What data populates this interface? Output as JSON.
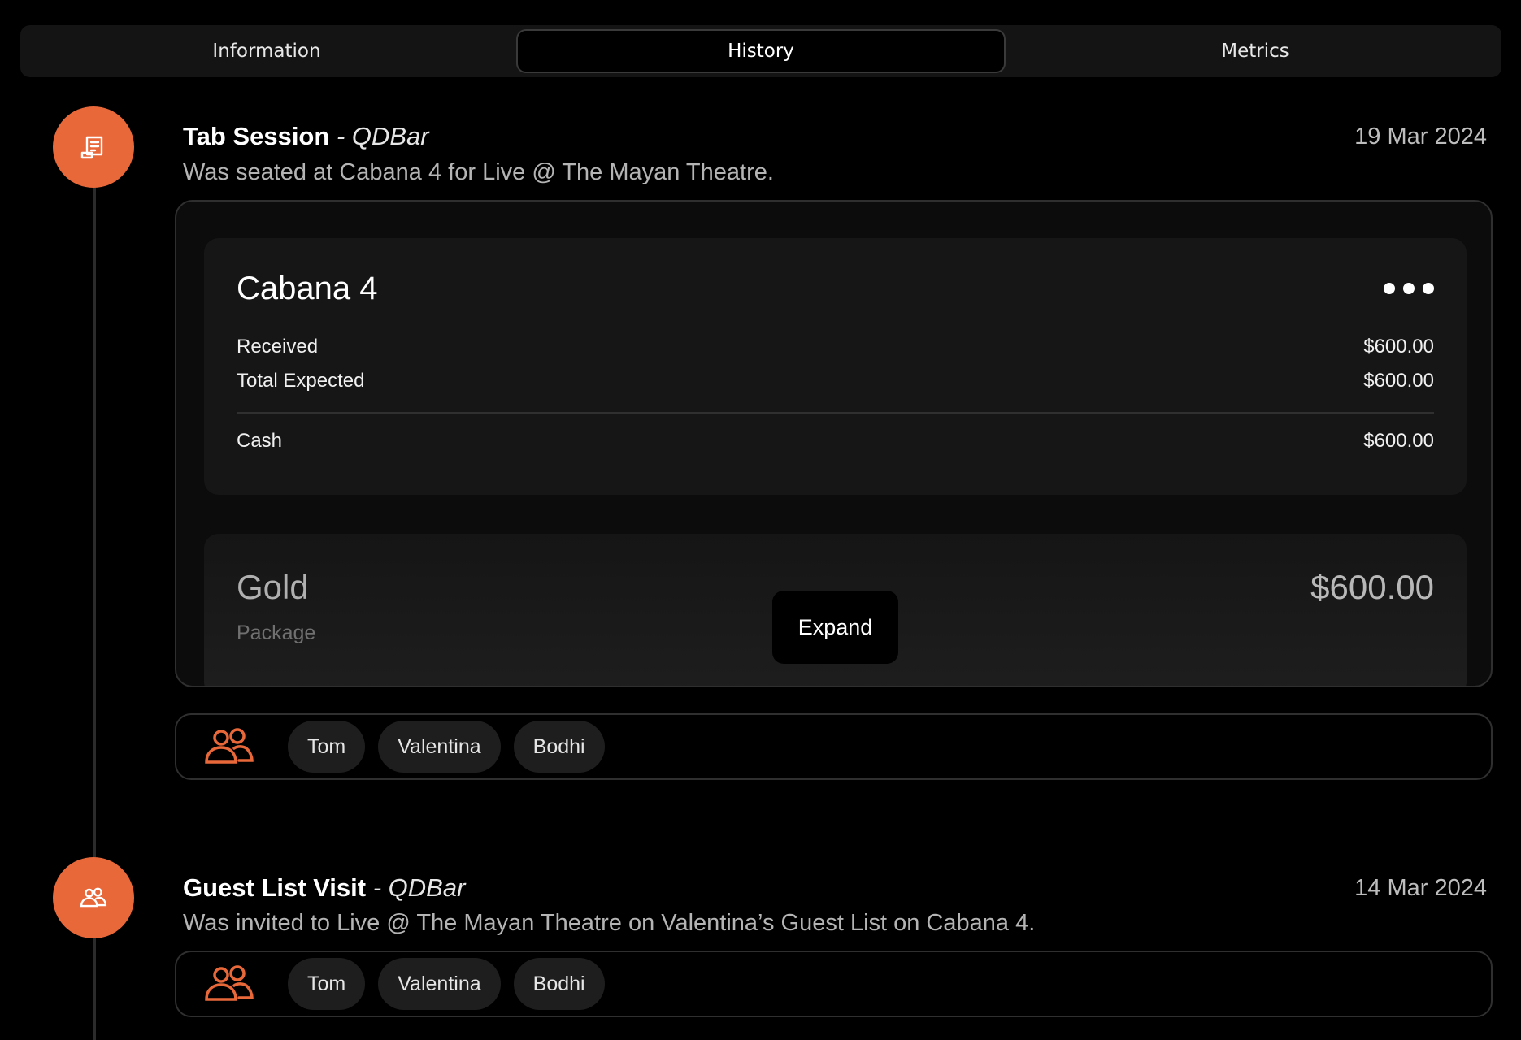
{
  "tabs": [
    "Information",
    "History",
    "Metrics"
  ],
  "active_tab": "History",
  "accent_color": "#e8683a",
  "entries": [
    {
      "title": "Tab Session",
      "venue": "- QDBar",
      "date": "19 Mar 2024",
      "description": "Was seated at Cabana 4 for Live @ The Mayan Theatre.",
      "icon": "receipt-icon",
      "tab": {
        "name": "Cabana 4",
        "received_label": "Received",
        "received_value": "$600.00",
        "expected_label": "Total Expected",
        "expected_value": "$600.00",
        "cash_label": "Cash",
        "cash_value": "$600.00"
      },
      "package": {
        "name": "Gold",
        "label": "Package",
        "price": "$600.00"
      },
      "expand_label": "Expand",
      "guests": [
        "Tom",
        "Valentina",
        "Bodhi"
      ]
    },
    {
      "title": "Guest List Visit",
      "venue": "- QDBar",
      "date": "14 Mar 2024",
      "description": "Was invited to Live @ The Mayan Theatre on Valentina’s Guest List on Cabana 4.",
      "icon": "people-icon",
      "guests": [
        "Tom",
        "Valentina",
        "Bodhi"
      ]
    }
  ]
}
